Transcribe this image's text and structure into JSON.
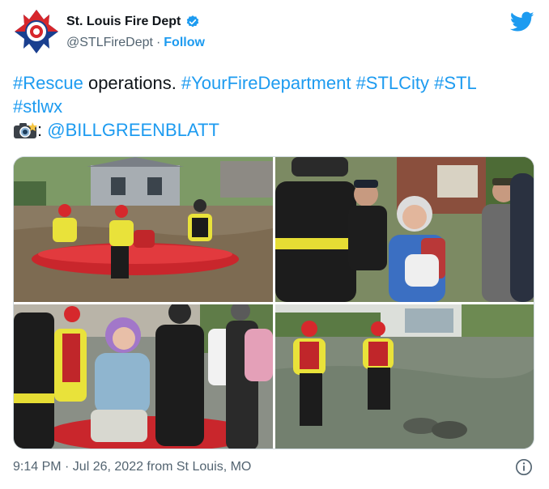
{
  "account": {
    "display_name": "St. Louis Fire Dept",
    "handle": "@STLFireDept",
    "separator": "·",
    "follow_label": "Follow",
    "avatar_icon": "fire-dept-maltese-cross-logo",
    "verified_icon": "verified-badge-icon"
  },
  "tweet": {
    "tag_rescue": "#Rescue",
    "plain_operations": " operations. ",
    "tag_yfd": "#YourFireDepartment",
    "tag_stlcity": "#STLCity",
    "tag_stl": "#STL",
    "tag_stlwx": "#stlwx",
    "camera_icon": "camera-flash-emoji-icon",
    "colon": ": ",
    "mention": "@BILLGREENBLATT"
  },
  "media": {
    "photos": [
      "flood-rescue-boat-street",
      "firefighters-assist-elderly-woman",
      "woman-carried-in-rescue-boat",
      "firefighters-wading-floodwater"
    ]
  },
  "footer": {
    "timestamp": "9:14 PM · Jul 26, 2022 from St Louis, MO",
    "info_icon": "info-icon"
  },
  "colors": {
    "link": "#1d9bf0",
    "text": "#0f1419",
    "muted": "#536471",
    "twitter_blue": "#1d9bf0"
  }
}
